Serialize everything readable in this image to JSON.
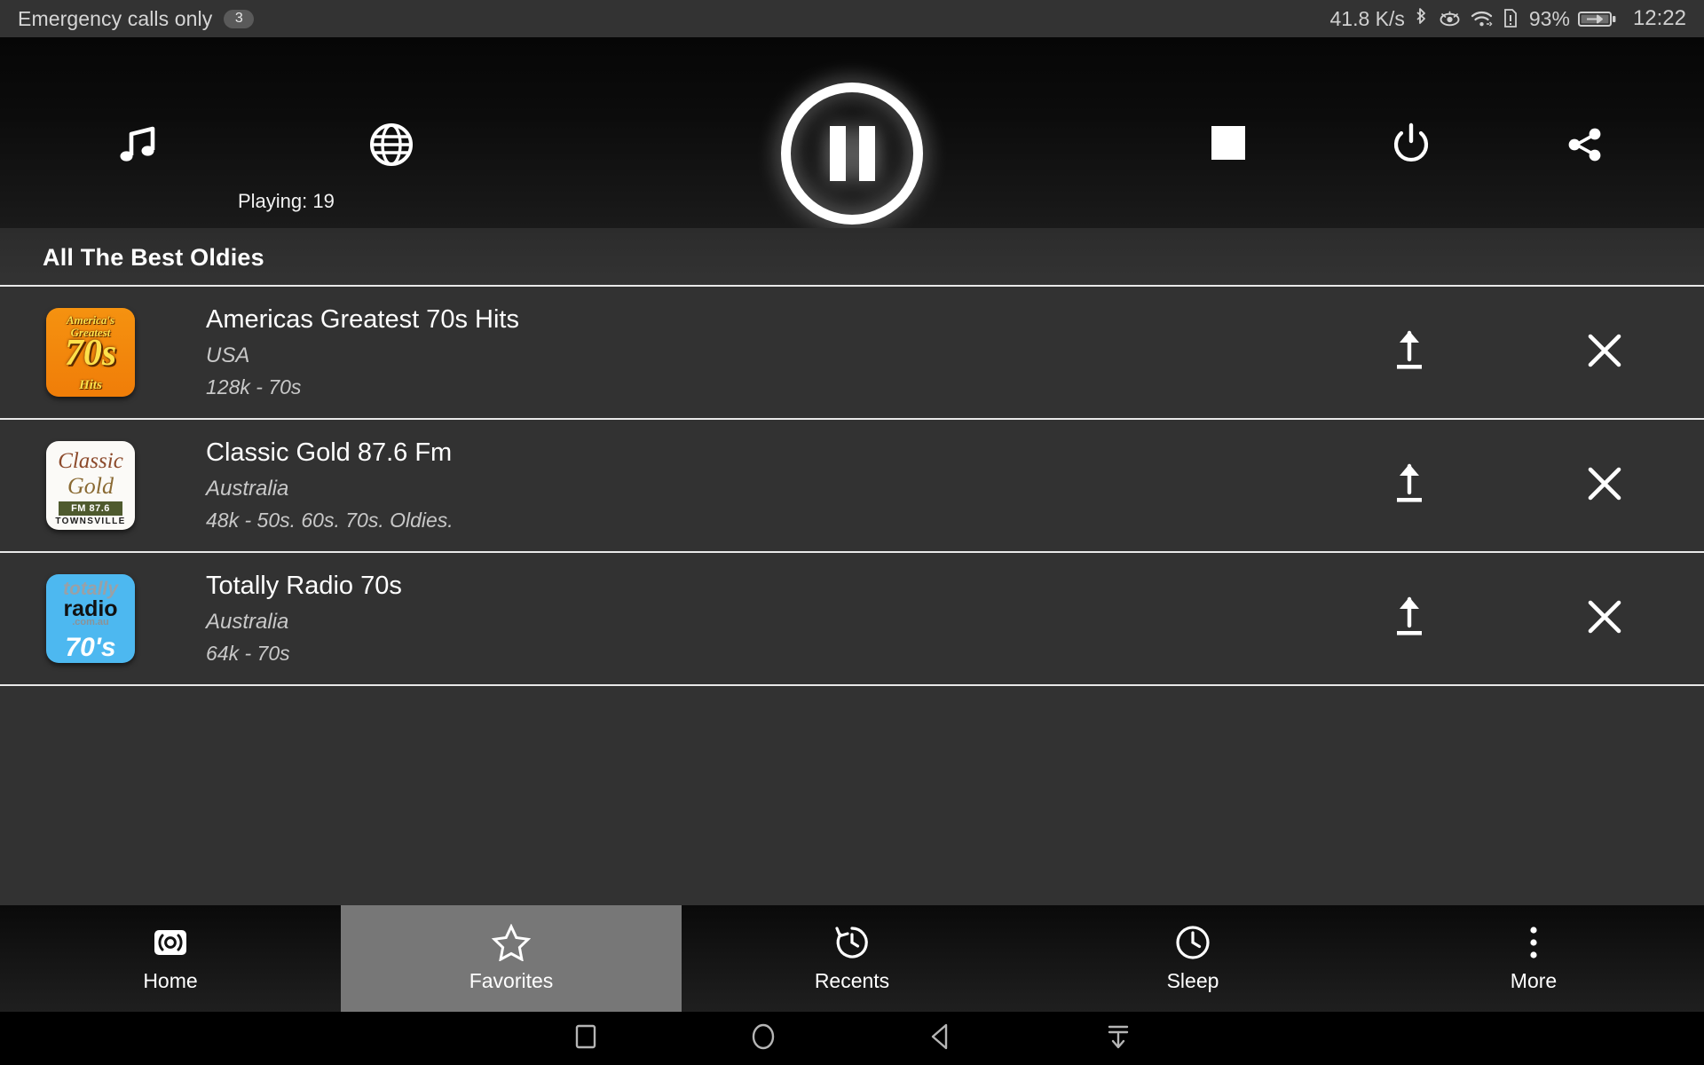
{
  "status_bar": {
    "carrier": "Emergency calls only",
    "notification_count": "3",
    "network_speed": "41.8 K/s",
    "battery_percent": "93%",
    "time": "12:22",
    "icons": [
      "bluetooth-icon",
      "eye-icon",
      "wifi-icon",
      "sim-alert-icon",
      "battery-charging-icon"
    ]
  },
  "player": {
    "music_icon": "music-note-icon",
    "globe_icon": "globe-icon",
    "playing_label": "Playing: 19",
    "play_pause_state": "pause-icon",
    "stop_icon": "stop-icon",
    "power_icon": "power-icon",
    "share_icon": "share-icon"
  },
  "section": {
    "title": "All The Best Oldies"
  },
  "stations": [
    {
      "name": "Americas Greatest 70s Hits",
      "country": "USA",
      "meta": "128k - 70s",
      "logo": {
        "style": "t1",
        "line1": "America's",
        "line2": "Greatest",
        "big": "70s",
        "line3": "Hits"
      },
      "move_icon": "move-to-top-icon",
      "delete_icon": "close-icon"
    },
    {
      "name": "Classic Gold 87.6 Fm",
      "country": "Australia",
      "meta": "48k - 50s. 60s. 70s. Oldies.",
      "logo": {
        "style": "t2",
        "line1": "Classic",
        "line2": "Gold",
        "badge": "FM 87.6",
        "line3": "TOWNSVILLE"
      },
      "move_icon": "move-to-top-icon",
      "delete_icon": "close-icon"
    },
    {
      "name": "Totally Radio 70s",
      "country": "Australia",
      "meta": "64k - 70s",
      "logo": {
        "style": "t3",
        "line1": "totally",
        "line2": "radio",
        "line3": ".com.au",
        "big": "70's"
      },
      "move_icon": "move-to-top-icon",
      "delete_icon": "close-icon"
    }
  ],
  "tabs": [
    {
      "label": "Home",
      "icon": "broadcast-icon",
      "active": false
    },
    {
      "label": "Favorites",
      "icon": "star-icon",
      "active": true
    },
    {
      "label": "Recents",
      "icon": "history-icon",
      "active": false
    },
    {
      "label": "Sleep",
      "icon": "clock-icon",
      "active": false
    },
    {
      "label": "More",
      "icon": "more-vert-icon",
      "active": false
    }
  ],
  "system_nav": {
    "recents_icon": "square-icon",
    "home_icon": "circle-icon",
    "back_icon": "triangle-back-icon",
    "hide_icon": "hide-navbar-icon"
  },
  "colors": {
    "background": "#323232",
    "player_background": "#0c0c0c",
    "divider": "#e9e9e9",
    "accent_tab_active": "#777777",
    "logo1_bg": "#f59210",
    "logo2_bg": "#fbfaf7",
    "logo3_bg": "#4db8f0"
  }
}
